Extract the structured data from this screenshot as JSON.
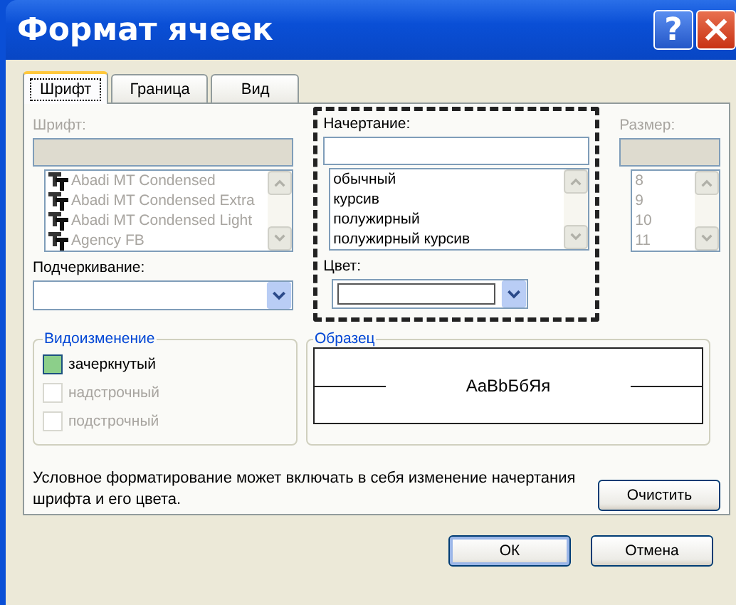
{
  "window": {
    "title": "Формат ячеек",
    "help": "?",
    "close": "×"
  },
  "tabs": [
    {
      "label": "Шрифт",
      "selected": true
    },
    {
      "label": "Граница",
      "selected": false
    },
    {
      "label": "Вид",
      "selected": false
    }
  ],
  "font": {
    "label": "Шрифт:",
    "disabled": true,
    "items": [
      {
        "label": "Abadi MT Condensed"
      },
      {
        "label": "Abadi MT Condensed Extra"
      },
      {
        "label": "Abadi MT Condensed Light"
      },
      {
        "label": "Agency FB"
      }
    ]
  },
  "style": {
    "label": "Начертание:",
    "disabled": false,
    "items": [
      {
        "label": "обычный"
      },
      {
        "label": "курсив"
      },
      {
        "label": "полужирный"
      },
      {
        "label": "полужирный курсив"
      }
    ]
  },
  "size": {
    "label": "Размер:",
    "disabled": true,
    "items": [
      {
        "label": "8"
      },
      {
        "label": "9"
      },
      {
        "label": "10"
      },
      {
        "label": "11"
      }
    ]
  },
  "underline": {
    "label": "Подчеркивание:"
  },
  "color": {
    "label": "Цвет:"
  },
  "effects": {
    "title": "Видоизменение",
    "items": [
      {
        "label": "зачеркнутый",
        "checked": true,
        "disabled": false
      },
      {
        "label": "надстрочный",
        "checked": false,
        "disabled": true
      },
      {
        "label": "подстрочный",
        "checked": false,
        "disabled": true
      }
    ]
  },
  "preview": {
    "title": "Образец",
    "sample": "AaBbБбЯя"
  },
  "note": "Условное форматирование может включать в себя изменение начертания шрифта и его цвета.",
  "clear_button": "Очистить",
  "buttons": [
    "ОК",
    "Отмена"
  ]
}
